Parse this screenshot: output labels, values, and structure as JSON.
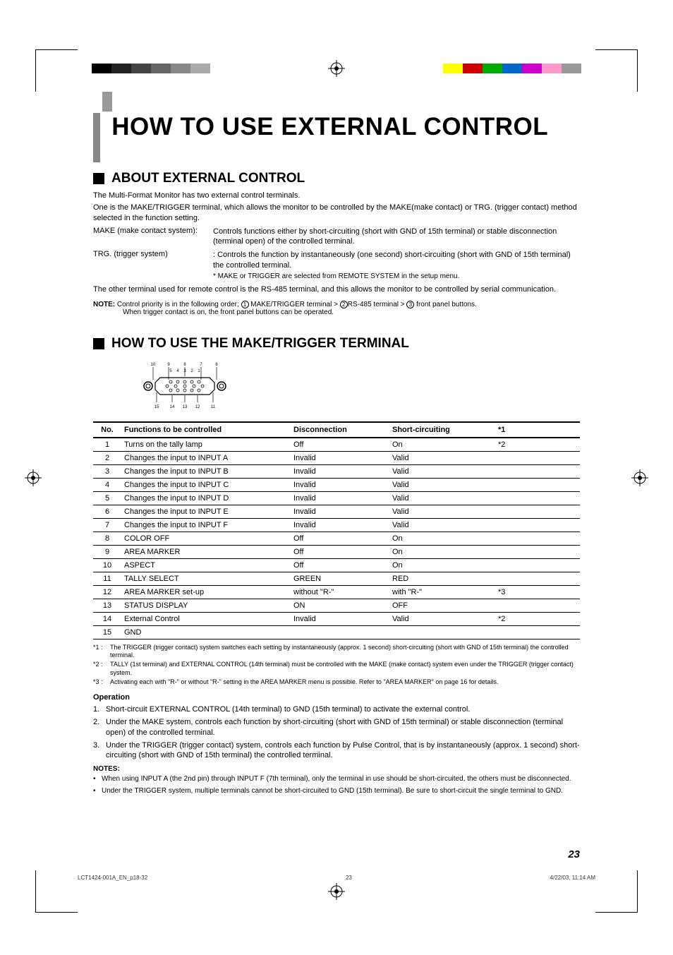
{
  "title": "HOW TO USE EXTERNAL CONTROL",
  "section1": {
    "heading": "ABOUT EXTERNAL CONTROL",
    "p1": "The Multi-Format Monitor has two external control terminals.",
    "p2": "One is the MAKE/TRIGGER terminal, which allows the monitor to be controlled by the MAKE(make contact) or TRG. (trigger contact) method selected in the function setting.",
    "make_label": "MAKE (make contact system):",
    "make_text": "Controls functions either by short-circuiting (short with GND of 15th terminal) or stable disconnection (terminal open) of the controlled terminal.",
    "trg_label": "TRG. (trigger system)",
    "trg_text": ": Controls the function by instantaneously (one second) short-circuiting (short with GND of 15th terminal) the controlled terminal.",
    "asterisk": "* MAKE or TRIGGER are selected from REMOTE SYSTEM in the setup menu.",
    "p3": "The other terminal used for remote control is the RS-485 terminal, and this allows the monitor to be controlled by serial communication.",
    "note_label": "NOTE:",
    "note1a": "Control priority is in the following order; ",
    "note1b": " MAKE/TRIGGER terminal > ",
    "note1c": "RS-485 terminal > ",
    "note1d": " front panel buttons.",
    "note2": "When trigger contact is on, the front panel buttons can be operated."
  },
  "section2": {
    "heading": "HOW TO USE THE MAKE/TRIGGER TERMINAL",
    "pin_labels_top": [
      "10",
      "9",
      "8",
      "7",
      "6"
    ],
    "pin_labels_mid": [
      "5",
      "4",
      "3",
      "2",
      "1"
    ],
    "pin_labels_bot": [
      "15",
      "14",
      "13",
      "12",
      "11"
    ],
    "table_headers": {
      "no": "No.",
      "func": "Functions to be controlled",
      "disc": "Disconnection",
      "short": "Short-circuiting",
      "star": "*1"
    },
    "rows": [
      {
        "no": "1",
        "func": "Turns on the tally lamp",
        "disc": "Off",
        "short": "On",
        "star": "*2"
      },
      {
        "no": "2",
        "func": "Changes the input to INPUT A",
        "disc": "Invalid",
        "short": "Valid",
        "star": ""
      },
      {
        "no": "3",
        "func": "Changes the input to INPUT B",
        "disc": "Invalid",
        "short": "Valid",
        "star": ""
      },
      {
        "no": "4",
        "func": "Changes the input to INPUT C",
        "disc": "Invalid",
        "short": "Valid",
        "star": ""
      },
      {
        "no": "5",
        "func": "Changes the input to INPUT D",
        "disc": "Invalid",
        "short": "Valid",
        "star": ""
      },
      {
        "no": "6",
        "func": "Changes the input to INPUT E",
        "disc": "Invalid",
        "short": "Valid",
        "star": ""
      },
      {
        "no": "7",
        "func": "Changes the input to INPUT F",
        "disc": "Invalid",
        "short": "Valid",
        "star": ""
      },
      {
        "no": "8",
        "func": "COLOR OFF",
        "disc": "Off",
        "short": "On",
        "star": ""
      },
      {
        "no": "9",
        "func": "AREA MARKER",
        "disc": "Off",
        "short": "On",
        "star": ""
      },
      {
        "no": "10",
        "func": "ASPECT",
        "disc": "Off",
        "short": "On",
        "star": ""
      },
      {
        "no": "11",
        "func": "TALLY SELECT",
        "disc": "GREEN",
        "short": "RED",
        "star": ""
      },
      {
        "no": "12",
        "func": "AREA MARKER set-up",
        "disc": "without \"R-\"",
        "short": "with \"R-\"",
        "star": "*3"
      },
      {
        "no": "13",
        "func": "STATUS DISPLAY",
        "disc": "ON",
        "short": "OFF",
        "star": ""
      },
      {
        "no": "14",
        "func": "External Control",
        "disc": "Invalid",
        "short": "Valid",
        "star": "*2"
      },
      {
        "no": "15",
        "func": "GND",
        "disc": "",
        "short": "",
        "star": ""
      }
    ],
    "footnotes": [
      {
        "label": "*1 :",
        "text": "The TRIGGER (trigger contact) system switches each setting by instantaneously (approx. 1 second) short-circuiting (short with GND of 15th terminal) the controlled terminal."
      },
      {
        "label": "*2 :",
        "text": "TALLY (1st terminal) and EXTERNAL CONTROL (14th terminal) must be controlled with the MAKE (make contact) system even under the TRIGGER (trigger contact) system."
      },
      {
        "label": "*3 :",
        "text": "Activating each with \"R-\" or without \"R-\" setting in the AREA MARKER menu is possible. Refer to \"AREA MARKER\" on page 16 for details."
      }
    ],
    "operation_heading": "Operation",
    "operations": [
      "Short-circuit EXTERNAL CONTROL (14th terminal) to GND (15th terminal) to activate the external control.",
      "Under the MAKE system, controls each function by short-circuiting (short with GND of 15th terminal) or stable disconnection (terminal open) of the controlled terminal.",
      "Under the TRIGGER (trigger contact) system, controls each function by Pulse Control, that is by instantaneously (approx. 1 second) short-circuiting (short with GND of 15th terminal) the controlled terminal."
    ],
    "notes_heading": "NOTES:",
    "notes": [
      "When using INPUT A (the 2nd pin) through INPUT F (7th terminal), only the terminal in use should be short-circuited, the others must be disconnected.",
      "Under the TRIGGER system, multiple terminals cannot be short-circuited to GND (15th terminal). Be sure to short-circuit the single terminal to GND."
    ]
  },
  "page_number": "23",
  "footer": {
    "left": "LCT1424-001A_EN_p18-32",
    "center": "23",
    "right": "4/22/03, 11:14 AM"
  }
}
